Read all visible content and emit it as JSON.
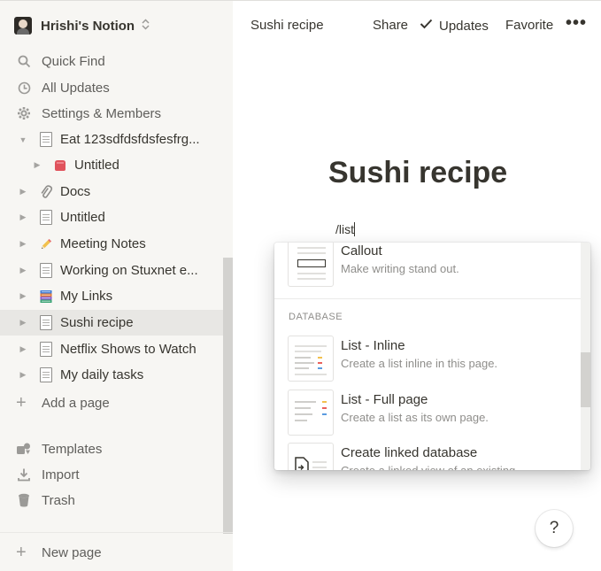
{
  "workspace": {
    "name": "Hrishi's Notion",
    "switch_icon": "chevron-up-down-icon"
  },
  "sidebar": {
    "menu": [
      {
        "label": "Quick Find",
        "icon": "search-icon"
      },
      {
        "label": "All Updates",
        "icon": "clock-icon"
      },
      {
        "label": "Settings & Members",
        "icon": "gear-icon"
      }
    ],
    "pages": [
      {
        "label": "Eat 123sdfdsfdsfesfrg...",
        "icon": "page-icon",
        "expanded": true
      },
      {
        "label": "Untitled",
        "icon": "red-block-icon",
        "nested": true
      },
      {
        "label": "Docs",
        "icon": "paperclip-icon"
      },
      {
        "label": "Untitled",
        "icon": "page-icon"
      },
      {
        "label": "Meeting Notes",
        "icon": "pencil-icon"
      },
      {
        "label": "Working on Stuxnet e...",
        "icon": "page-icon"
      },
      {
        "label": "My Links",
        "icon": "books-icon"
      },
      {
        "label": "Sushi recipe",
        "icon": "page-icon",
        "selected": true
      },
      {
        "label": "Netflix Shows to Watch",
        "icon": "page-icon"
      },
      {
        "label": "My daily tasks",
        "icon": "page-icon"
      }
    ],
    "add_page": "Add a page",
    "footer": [
      {
        "label": "Templates",
        "icon": "templates-icon"
      },
      {
        "label": "Import",
        "icon": "import-icon"
      },
      {
        "label": "Trash",
        "icon": "trash-icon"
      }
    ],
    "new_page": "New page"
  },
  "topbar": {
    "breadcrumb": "Sushi recipe",
    "share": "Share",
    "updates": "Updates",
    "favorite": "Favorite",
    "more": "•••"
  },
  "page": {
    "title": "Sushi recipe",
    "command_text": "/list"
  },
  "popup": {
    "callout": {
      "label": "Callout",
      "desc": "Make writing stand out."
    },
    "section": "DATABASE",
    "items": [
      {
        "label": "List - Inline",
        "desc": "Create a list inline in this page."
      },
      {
        "label": "List - Full page",
        "desc": "Create a list as its own page."
      },
      {
        "label": "Create linked database",
        "desc": "Create a linked view of an existing..."
      }
    ]
  },
  "help": "?",
  "colors": {
    "sidebar_bg": "#f7f6f3",
    "text": "#37352f",
    "muted": "#9b9a97",
    "selected_bg": "#e8e7e4"
  }
}
